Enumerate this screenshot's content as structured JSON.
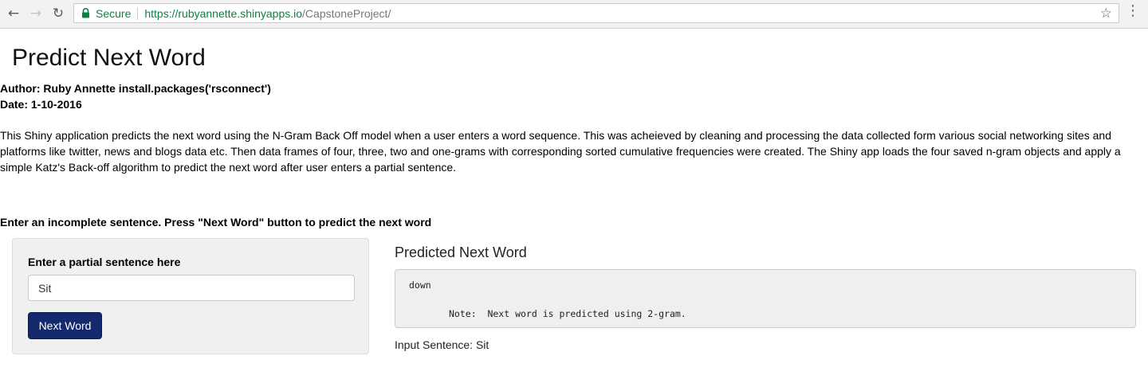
{
  "browser": {
    "secure_label": "Secure",
    "url_host": "https://rubyannette.shinyapps.io",
    "url_path": "/CapstoneProject/",
    "icons": [
      "back-arrow-icon",
      "forward-arrow-icon",
      "reload-icon",
      "lock-icon",
      "star-icon",
      "menu-dots-icon"
    ]
  },
  "page": {
    "title": "Predict Next Word",
    "author_line": "Author: Ruby Annette install.packages('rsconnect')",
    "date_line": "Date: 1-10-2016",
    "description": "This Shiny application predicts the next word using the N-Gram Back Off model when a user enters a word sequence. This was acheieved by cleaning and processing the data collected form various social networking sites and platforms like twitter, news and blogs data etc. Then data frames of four, three, two and one-grams with corresponding sorted cumulative frequencies were created. The Shiny app loads the four saved n-gram objects and apply a simple Katz's Back-off algorithm to predict the next word after user enters a partial sentence.",
    "instruction": "Enter an incomplete sentence. Press \"Next Word\" button to predict the next word"
  },
  "input_panel": {
    "label": "Enter a partial sentence here",
    "value": "Sit",
    "button_label": "Next Word"
  },
  "output_panel": {
    "heading": "Predicted Next Word",
    "predicted_word": "down",
    "note": "Note:  Next word is predicted using 2-gram.",
    "input_sentence": "Input Sentence: Sit"
  },
  "colors": {
    "button_bg": "#14296e",
    "secure_green": "#0b8043",
    "well_bg": "#f0f0f0"
  }
}
